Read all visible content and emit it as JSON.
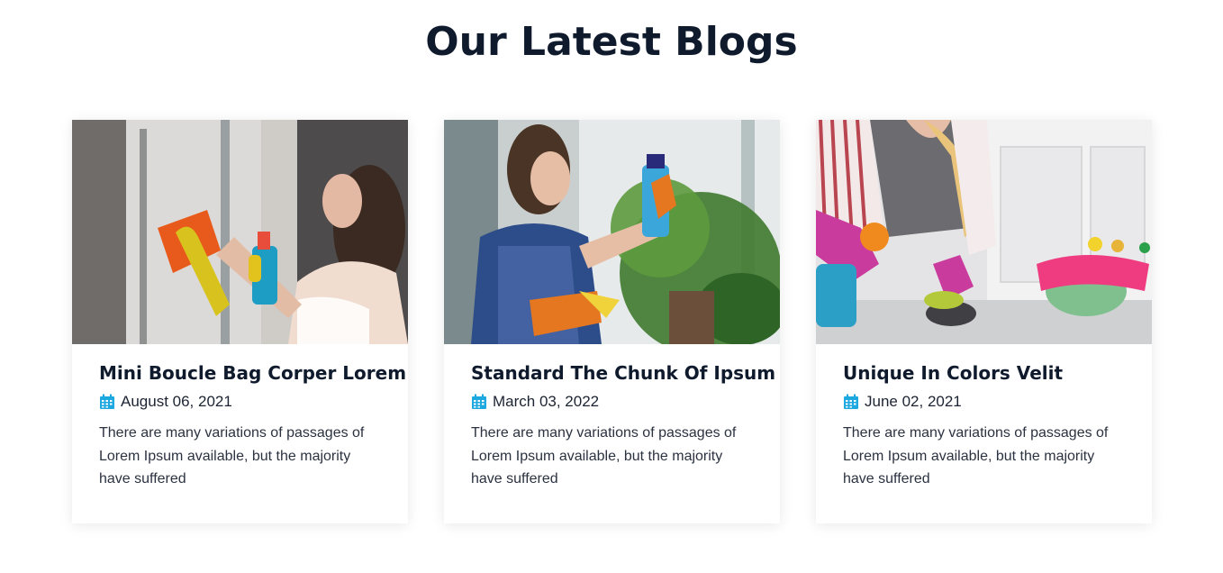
{
  "section": {
    "title": "Our Latest Blogs"
  },
  "posts": [
    {
      "title": "Mini Boucle Bag Corper Lorem",
      "date": "August 06, 2021",
      "excerpt": "There are many variations of passages of Lorem Ipsum available, but the majority have suffered"
    },
    {
      "title": "Standard The Chunk Of Ipsum",
      "date": "March 03, 2022",
      "excerpt": "There are many variations of passages of Lorem Ipsum available, but the majority have suffered"
    },
    {
      "title": "Unique In Colors Velit",
      "date": "June 02, 2021",
      "excerpt": "There are many variations of passages of Lorem Ipsum available, but the majority have suffered"
    }
  ],
  "colors": {
    "heading": "#0f1b2d",
    "icon_accent": "#1ea8e0",
    "body_text": "#2b3240"
  },
  "icons": {
    "date": "calendar-icon"
  }
}
